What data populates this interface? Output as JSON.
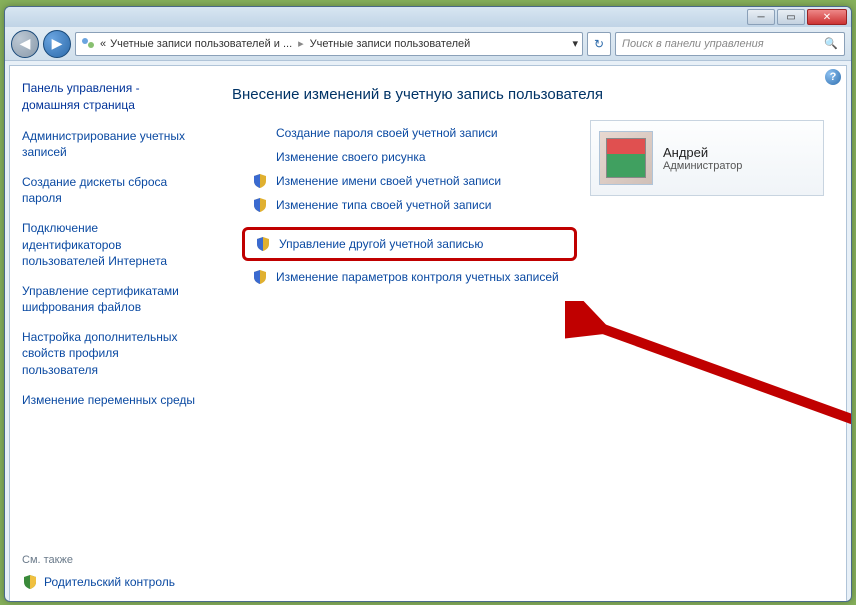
{
  "window": {
    "minimize": "─",
    "maximize": "▭",
    "close": "✕"
  },
  "nav": {
    "back": "◀",
    "forward": "▶"
  },
  "breadcrumb": {
    "level1_prefix": "«",
    "level1": "Учетные записи пользователей и ...",
    "level2": "Учетные записи пользователей",
    "sep": "▸",
    "dropdown": "▾"
  },
  "search": {
    "placeholder": "Поиск в панели управления",
    "icon": "🔍"
  },
  "sidebar": {
    "home": "Панель управления - домашняя страница",
    "links": [
      "Администрирование учетных записей",
      "Создание дискеты сброса пароля",
      "Подключение идентификаторов пользователей Интернета",
      "Управление сертификатами шифрования файлов",
      "Настройка дополнительных свойств профиля пользователя",
      "Изменение переменных среды"
    ],
    "also_label": "См. также",
    "bottom_link": "Родительский контроль"
  },
  "main": {
    "heading": "Внесение изменений в учетную запись пользователя",
    "tasks_top": [
      {
        "shield": false,
        "label": "Создание пароля своей учетной записи"
      },
      {
        "shield": false,
        "label": "Изменение своего рисунка"
      },
      {
        "shield": true,
        "label": "Изменение имени своей учетной записи"
      },
      {
        "shield": true,
        "label": "Изменение типа своей учетной записи"
      }
    ],
    "highlighted": {
      "shield": true,
      "label": "Управление другой учетной записью"
    },
    "tasks_bottom": [
      {
        "shield": true,
        "label": "Изменение параметров контроля учетных записей"
      }
    ]
  },
  "user": {
    "name": "Андрей",
    "role": "Администратор"
  },
  "help": "?"
}
